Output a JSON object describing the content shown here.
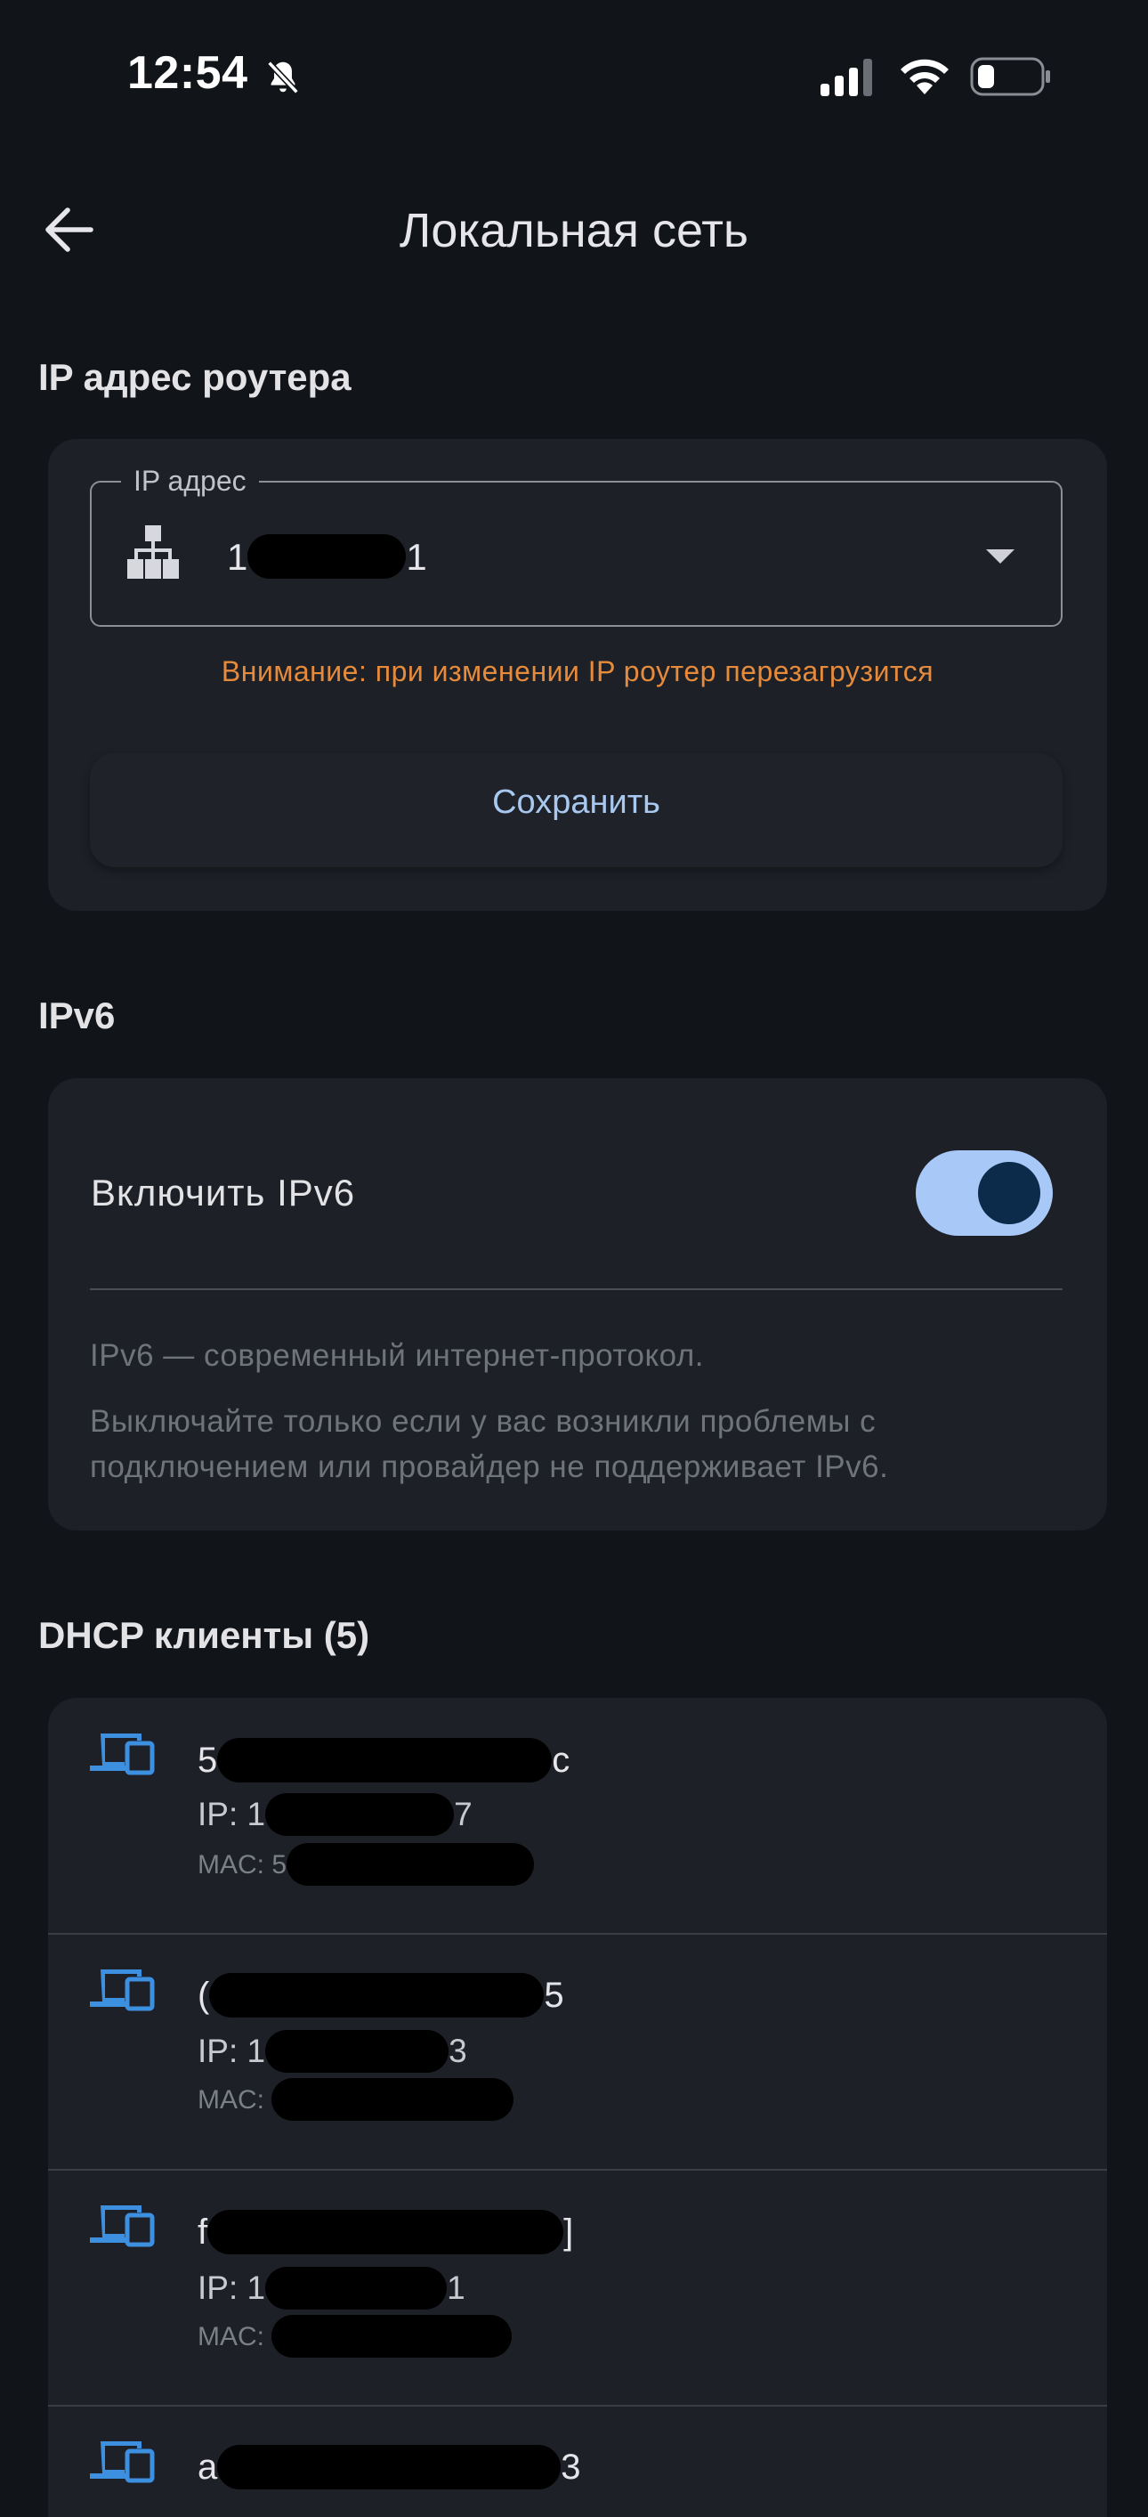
{
  "status_bar": {
    "time": "12:54",
    "icons": [
      "bell-slash-icon",
      "cellular-signal-icon",
      "wifi-icon",
      "battery-icon"
    ]
  },
  "app_bar": {
    "title": "Локальная сеть",
    "back_icon": "arrow-left-icon"
  },
  "router_ip_section": {
    "title": "IP адрес роутера",
    "field_label": "IP адрес",
    "ip_value_start": "1",
    "ip_value_end": "1",
    "icon": "network-tree-icon",
    "dropdown_icon": "caret-down-icon",
    "warning": "Внимание: при изменении IP роутер перезагрузится",
    "save_label": "Сохранить"
  },
  "ipv6_section": {
    "title": "IPv6",
    "toggle_label": "Включить IPv6",
    "enabled": true,
    "desc_1": "IPv6 — современный интернет-протокол.",
    "desc_2_line1": "Выключайте только если у вас возникли проблемы с",
    "desc_2_line2": "подключением или провайдер не поддерживает IPv6."
  },
  "dhcp_section": {
    "title": "DHCP клиенты (5)",
    "ip_prefix": "IP:",
    "mac_prefix": "MAC:",
    "clients": [
      {
        "name_start": "5",
        "name_end": "c",
        "ip_start": "1",
        "ip_end": "7",
        "mac_start": "5"
      },
      {
        "name_start": "(",
        "name_end": "5",
        "ip_start": "1",
        "ip_end": "3",
        "mac_start": ""
      },
      {
        "name_start": "f",
        "name_end": "]",
        "ip_start": "1",
        "ip_end": "1",
        "mac_start": ""
      },
      {
        "name_start": "a",
        "name_end": "3",
        "ip_start": "",
        "ip_end": "",
        "mac_start": ""
      }
    ]
  },
  "colors": {
    "background": "#111418",
    "card": "#1d2026",
    "accent": "#a8c8f8",
    "warning": "#e68a3c",
    "device_icon": "#3d8fe0"
  }
}
